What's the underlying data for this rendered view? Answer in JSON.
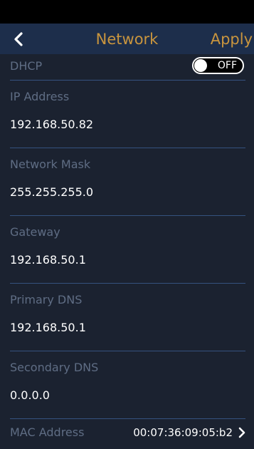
{
  "header": {
    "title": "Network",
    "apply_label": "Apply",
    "back_icon": "chevron-left-icon"
  },
  "dhcp": {
    "label": "DHCP",
    "toggle_state": "OFF"
  },
  "fields": [
    {
      "label": "IP Address",
      "value": "192.168.50.82"
    },
    {
      "label": "Network Mask",
      "value": "255.255.255.0"
    },
    {
      "label": "Gateway",
      "value": "192.168.50.1"
    },
    {
      "label": "Primary DNS",
      "value": "192.168.50.1"
    },
    {
      "label": "Secondary DNS",
      "value": "0.0.0.0"
    }
  ],
  "mac": {
    "label": "MAC Address",
    "value": "00:07:36:09:05:b2",
    "chevron_icon": "chevron-right-icon"
  },
  "colors": {
    "background": "#1b2230",
    "header_background": "#1d2e4b",
    "accent": "#c9953e",
    "divider": "#35527f",
    "label_text": "#5f6d84",
    "value_text": "#ffffff"
  }
}
